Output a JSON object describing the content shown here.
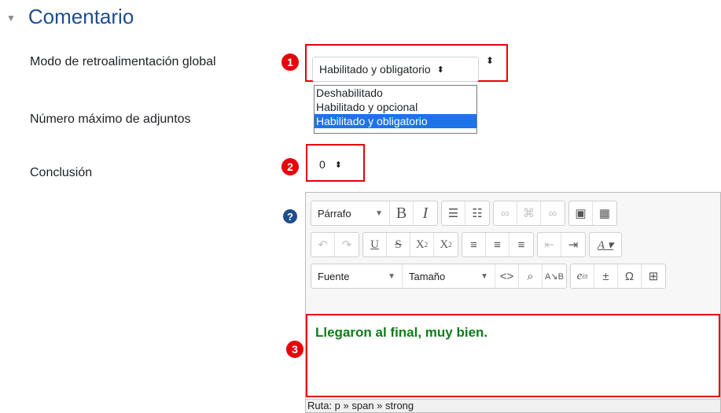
{
  "section": {
    "title": "Comentario",
    "toggle_icon": "caret-down-icon"
  },
  "fields": {
    "global_feedback_mode": {
      "label": "Modo de retroalimentación global",
      "badge": "1",
      "selected": "Habilitado y obligatorio",
      "options": [
        "Deshabilitado",
        "Habilitado y opcional",
        "Habilitado y obligatorio"
      ]
    },
    "max_attachments": {
      "label": "Número máximo de adjuntos"
    },
    "conclusion": {
      "label": "Conclusión",
      "badge": "2",
      "selected": "0"
    }
  },
  "editor": {
    "badge": "3",
    "help_icon": "question-icon",
    "paragraph_label": "Párrafo",
    "font_label": "Fuente",
    "size_label": "Tamaño",
    "content_text": "Llegaron al final, muy bien.",
    "path_text": "Ruta: p » span » strong"
  },
  "colors": {
    "accent": "#1f4e8c",
    "highlight": "#e8000b",
    "content_text": "#0b7d1a",
    "option_selected": "#1e73e8"
  }
}
